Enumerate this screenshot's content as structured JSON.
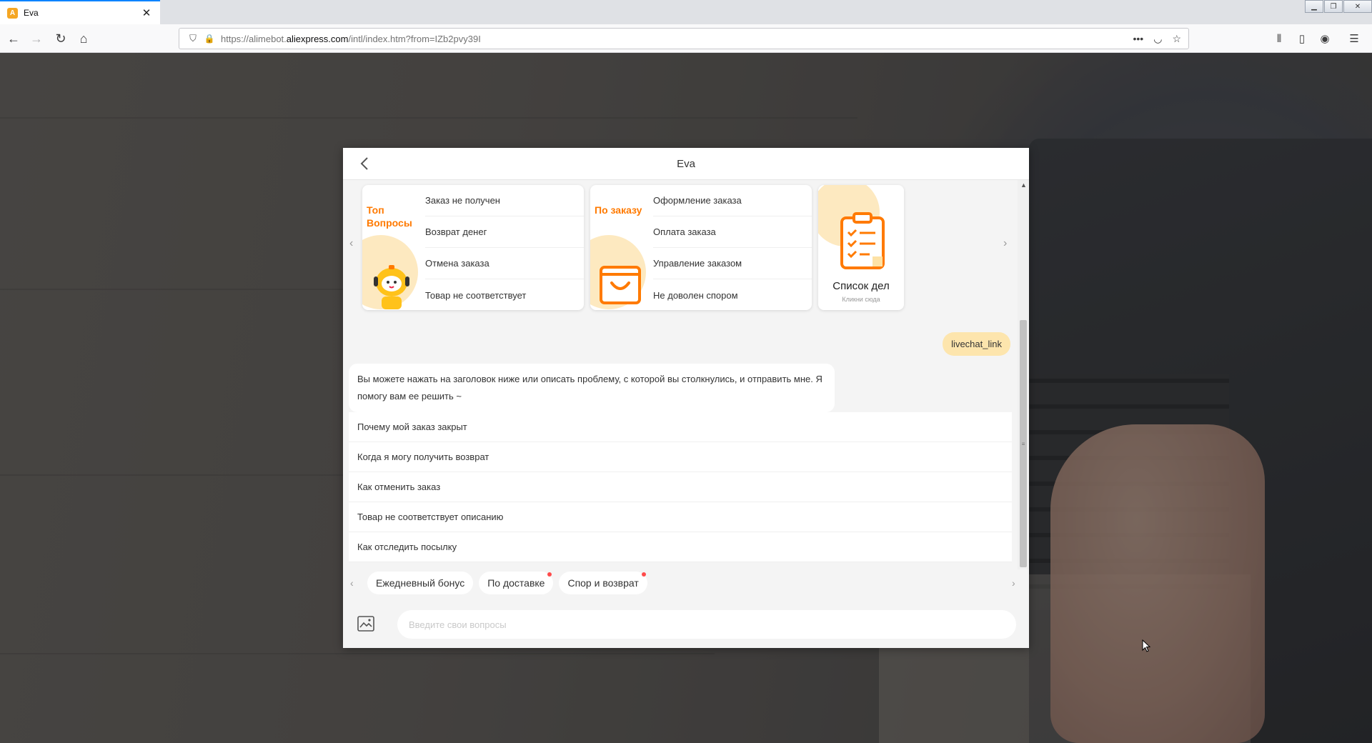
{
  "browser": {
    "tab_title": "Eva",
    "url_prefix": "https://alimebot.",
    "url_domain": "aliexpress.com",
    "url_suffix": "/intl/index.htm?from=IZb2pvy39I"
  },
  "chat": {
    "title": "Eva",
    "cards": [
      {
        "category": "Топ Вопросы",
        "items": [
          "Заказ не получен",
          "Возврат денег",
          "Отмена заказа",
          "Товар не соответствует"
        ]
      },
      {
        "category": "По заказу",
        "items": [
          "Оформление заказа",
          "Оплата заказа",
          "Управление заказом",
          "Не доволен спором"
        ]
      }
    ],
    "todo": {
      "title": "Список дел",
      "subtitle": "Кликни сюда"
    },
    "user_message": "livechat_link",
    "bot_message": "Вы можете нажать на заголовок ниже или описать проблему, с которой вы столкнулись, и отправить мне. Я помогу вам ее решить ~",
    "questions": [
      "Почему мой заказ закрыт",
      "Когда я могу получить возврат",
      "Как отменить заказ",
      "Товар не соответствует описанию",
      "Как отследить посылку"
    ],
    "chips": [
      "Ежедневный бонус",
      "По доставке",
      "Спор и возврат"
    ],
    "input_placeholder": "Введите свои вопросы"
  },
  "colors": {
    "accent": "#ff7a00",
    "user_bubble": "#fde5ad",
    "badge": "#ff4b4b"
  }
}
